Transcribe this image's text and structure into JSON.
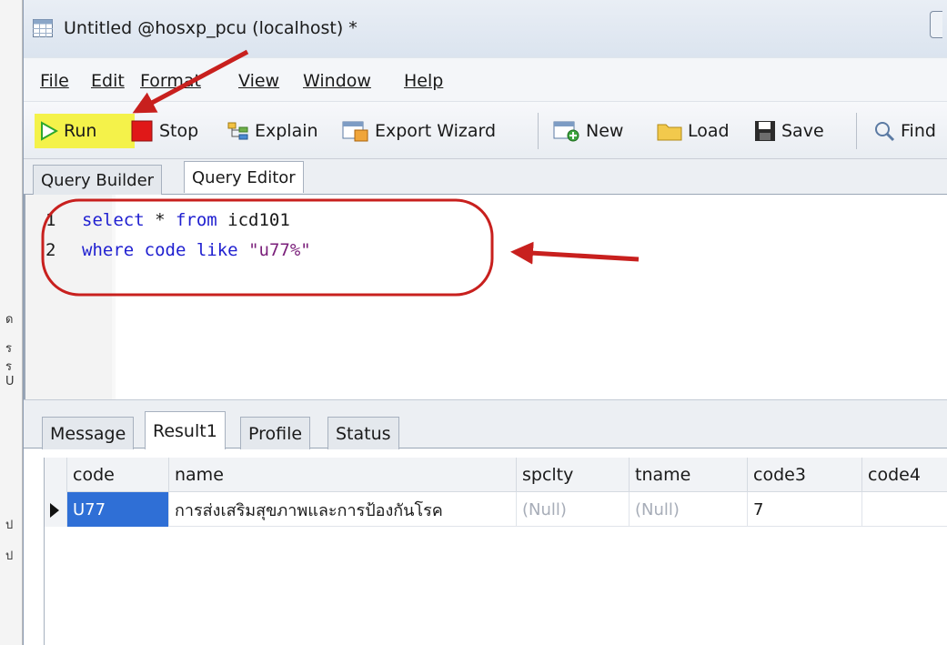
{
  "window": {
    "title": "Untitled @hosxp_pcu (localhost) *"
  },
  "menu": [
    "File",
    "Edit",
    "Format",
    "View",
    "Window",
    "Help"
  ],
  "toolbar": {
    "run": "Run",
    "stop": "Stop",
    "explain": "Explain",
    "export_wizard": "Export Wizard",
    "new": "New",
    "load": "Load",
    "save": "Save",
    "find": "Find"
  },
  "query_tabs": {
    "builder": "Query Builder",
    "editor": "Query Editor"
  },
  "editor": {
    "lines": [
      {
        "num": "1",
        "kw1": "select",
        "mid": " * ",
        "kw2": "from",
        "rest": " icd101"
      },
      {
        "num": "2",
        "kw1": "where",
        "mid": " ",
        "kw2": "code",
        "rest_kw": " like ",
        "str": "\"u77%\""
      }
    ]
  },
  "result_tabs": {
    "message": "Message",
    "result1": "Result1",
    "profile": "Profile",
    "status": "Status"
  },
  "grid": {
    "columns": [
      "code",
      "name",
      "spclty",
      "tname",
      "code3",
      "code4"
    ],
    "rows": [
      {
        "code": "U77",
        "name": "การส่งเสริมสุขภาพและการป้องกันโรค",
        "spclty": "(Null)",
        "tname": "(Null)",
        "code3": "7",
        "code4": ""
      }
    ]
  },
  "colors": {
    "highlight": "#f4f24a",
    "annotation": "#c8201e",
    "selection": "#2f6fd6",
    "keyword": "#1f1fd0"
  },
  "left_strip_chars": [
    "ด",
    "ร",
    "ร",
    "U",
    "ป",
    "ป"
  ]
}
